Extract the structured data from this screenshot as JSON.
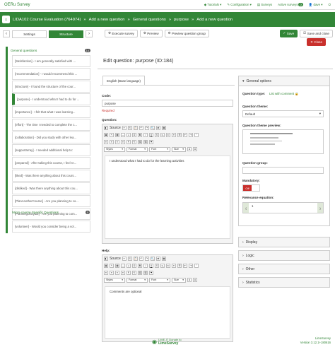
{
  "app": {
    "brand": "OERu Survey"
  },
  "topnav": {
    "tutorials": "Tutorials",
    "configuration": "Configuration",
    "surveys": "Surveys",
    "active_surveys": "Active surveys",
    "active_count": "0",
    "user": "dave"
  },
  "breadcrumb": {
    "survey": "LIDA102 Course Evaluation (764974)",
    "sep": "»",
    "add1": "Add a new question",
    "group": "General questions",
    "code": "purpose",
    "add2": "Add a new question"
  },
  "sidebar": {
    "tab_settings": "Settings",
    "tab_structure": "Structure",
    "group1": {
      "name": "General questions",
      "count": "14"
    },
    "items": [
      "[Satisfaction] - I am generally satisfied with ...",
      "[recommendation] - I would recommend this ...",
      "[structure] - I found the structure of the cour...",
      "[purpose] - I understood what I had to do for ...",
      "[importance] - I felt that what I was learning...",
      "[effort] - The time I needed to complete the c...",
      "[collaboration] - Did you study with other lea...",
      "[supportarray] - I needed additional help to:",
      "[prepared] - After taking this course, I feel re...",
      "[liked] - Was there anything about this cours...",
      "[disliked] - Was there anything about this cou...",
      "[PlanAnotherCourse] - Are you planning to co...",
      "[PlanningUniQual] - Are you planning to com...",
      "[volunteer] - Would you consider being a vol..."
    ],
    "group2": {
      "name": "Micro-course Specific Questions",
      "count": "0"
    }
  },
  "toolbar": {
    "execute": "Execute survey",
    "preview": "Preview",
    "preview_group": "Preview question group",
    "save": "Save",
    "save_close": "Save and close",
    "close": "Close"
  },
  "editor": {
    "title_prefix": "Edit question:",
    "title_code": "purpose",
    "title_id": "(ID:184)",
    "lang_tab": "English (Base language)",
    "code_label": "Code:",
    "code_value": "purpose",
    "required": "Required",
    "question_label": "Question:",
    "question_text": "I understood what I had to do for the learning activities",
    "help_label": "Help:",
    "help_text": "Comments are optional",
    "tb_source": "Source",
    "tb_styles": "Styles",
    "tb_format": "Format",
    "tb_font": "Font",
    "tb_size": "Size"
  },
  "options": {
    "general": "General options",
    "type_label": "Question type:",
    "type_value": "List with comment",
    "theme_label": "Question theme:",
    "theme_value": "Default",
    "preview_label": "Question theme preview:",
    "group_label": "Question group:",
    "mandatory_label": "Mandatory:",
    "mandatory_value": "Off",
    "relevance_label": "Relevance equation:",
    "relevance_value": "1",
    "display": "Display",
    "logic": "Logic",
    "other": "Other",
    "statistics": "Statistics"
  },
  "footer": {
    "logo_line1": "LIME-IT Donate to",
    "logo_line2": "LimeSurvey",
    "brand": "LimeSurvey",
    "version": "Version 3.12.1+180616"
  }
}
